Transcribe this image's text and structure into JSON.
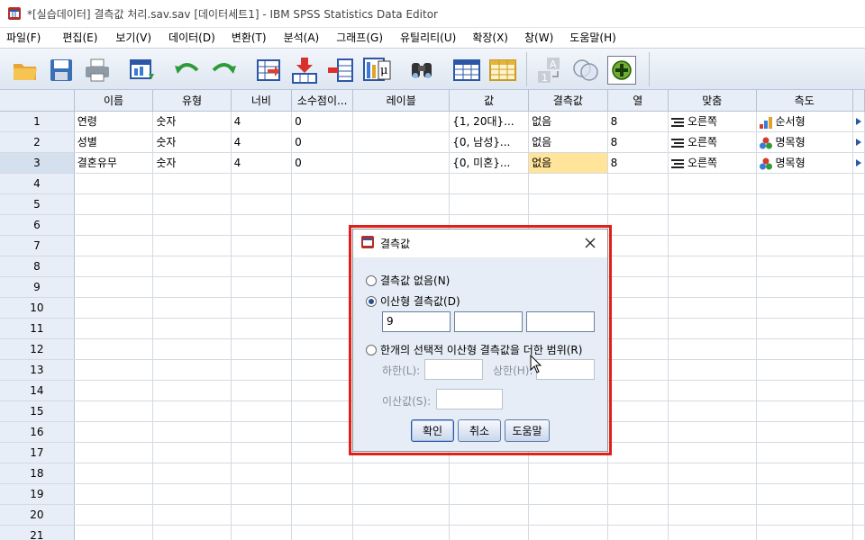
{
  "window": {
    "title": "*[실습데이터] 결측값 처리.sav.sav [데이터세트1] - IBM SPSS Statistics Data Editor"
  },
  "menu": [
    "파일(F)",
    "편집(E)",
    "보기(V)",
    "데이터(D)",
    "변환(T)",
    "분석(A)",
    "그래프(G)",
    "유틸리티(U)",
    "확장(X)",
    "창(W)",
    "도움말(H)"
  ],
  "toolbar": {
    "icons": [
      "open-folder-icon",
      "save-icon",
      "print-icon",
      "dialog-recall-icon",
      "undo-icon",
      "redo-icon",
      "goto-case-icon",
      "insert-cases-icon",
      "insert-variable-icon",
      "variables-icon",
      "find-icon",
      "split-file-icon",
      "weight-cases-icon",
      "value-labels-icon",
      "use-sets-icon",
      "add-icon"
    ]
  },
  "grid": {
    "headers": [
      "이름",
      "유형",
      "너비",
      "소수점이...",
      "레이블",
      "값",
      "결측값",
      "열",
      "맞춤",
      "측도"
    ],
    "rows": [
      {
        "num": "1",
        "name": "연령",
        "type": "숫자",
        "width": "4",
        "decimals": "0",
        "label": "",
        "values": "{1, 20대}...",
        "missing": "없음",
        "columns": "8",
        "align": "오른쪽",
        "measure": "순서형",
        "measure_icon": "ordinal-icon"
      },
      {
        "num": "2",
        "name": "성별",
        "type": "숫자",
        "width": "4",
        "decimals": "0",
        "label": "",
        "values": "{0, 남성}...",
        "missing": "없음",
        "columns": "8",
        "align": "오른쪽",
        "measure": "명목형",
        "measure_icon": "nominal-icon"
      },
      {
        "num": "3",
        "name": "결혼유무",
        "type": "숫자",
        "width": "4",
        "decimals": "0",
        "label": "",
        "values": "{0, 미혼}...",
        "missing": "없음",
        "columns": "8",
        "align": "오른쪽",
        "measure": "명목형",
        "measure_icon": "nominal-icon"
      }
    ],
    "empty_rows": [
      "4",
      "5",
      "6",
      "7",
      "8",
      "9",
      "10",
      "11",
      "12",
      "13",
      "14",
      "15",
      "16",
      "17",
      "18",
      "19",
      "20",
      "21"
    ]
  },
  "dialog": {
    "title": "결측값",
    "option_none": "결측값 없음(N)",
    "option_discrete": "이산형 결측값(D)",
    "discrete_values": [
      "9",
      "",
      ""
    ],
    "option_range": "한개의 선택적 이산형 결측값을 더한 범위(R)",
    "low_label": "하한(L):",
    "high_label": "상한(H):",
    "discrete_label": "이산값(S):",
    "ok": "확인",
    "cancel": "취소",
    "help": "도움말",
    "selected": "discrete"
  },
  "colors": {
    "highlight_cell": "#ffe49a",
    "dialog_frame": "#e0201b",
    "header_bg": "#e8eef7"
  }
}
